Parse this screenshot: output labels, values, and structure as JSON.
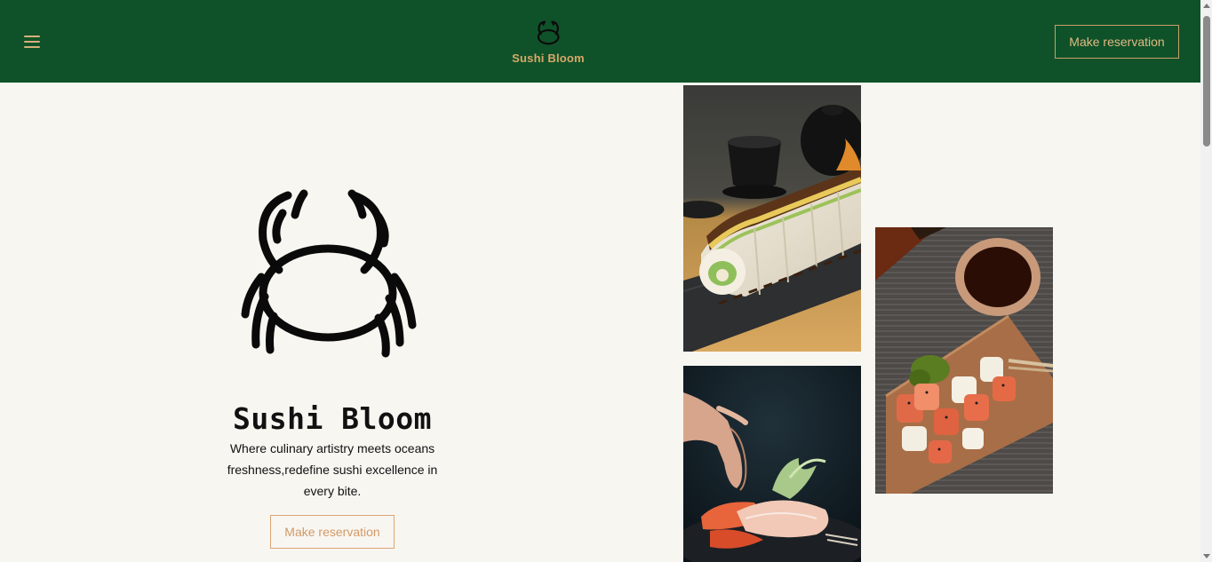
{
  "header": {
    "brand_name": "Sushi Bloom",
    "cta_label": "Make reservation",
    "menu_icon": "hamburger-icon",
    "logo_icon": "crab-icon"
  },
  "hero": {
    "title": "Sushi Bloom",
    "description": "Where culinary artistry meets oceans freshness,redefine sushi excellence in every bite.",
    "cta_label": "Make reservation",
    "logo_icon": "crab-icon"
  },
  "gallery": {
    "photos": [
      "sushi-roll-photo",
      "salmon-rolls-photo",
      "sashimi-plating-photo"
    ]
  },
  "colors": {
    "header_bg": "#0f5229",
    "accent_gold": "#d9a868",
    "page_bg": "#f8f6f1"
  }
}
